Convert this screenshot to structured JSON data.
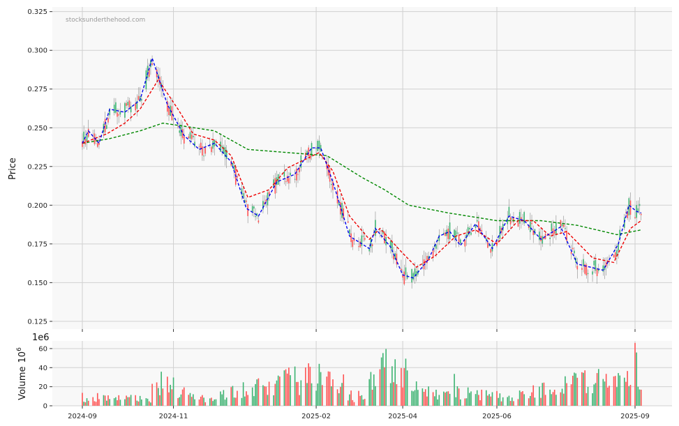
{
  "chart_data": {
    "type": "candlestick",
    "watermark": "stocksunderthehood.com",
    "colors": {
      "up": "#3cb371",
      "down": "#ff5252",
      "ma_fast": "#0000ee",
      "ma_mid": "#ee0000",
      "ma_slow": "#008800",
      "grid": "#d0d0d0",
      "panel_bg": "#f8f8f8"
    },
    "price_panel": {
      "ylabel": "Price",
      "ylim": [
        0.12,
        0.328
      ],
      "yticks": [
        "0.125",
        "0.150",
        "0.175",
        "0.200",
        "0.225",
        "0.250",
        "0.275",
        "0.300",
        "0.325"
      ],
      "grid": true
    },
    "volume_panel": {
      "ylabel": "Volume",
      "unit_label": "10",
      "unit_exp": "6",
      "offset_label": "1e6",
      "ylim": [
        0,
        68
      ],
      "yticks": [
        "0",
        "20",
        "40",
        "60"
      ],
      "grid": true
    },
    "xaxis": {
      "start": "2024-09-02",
      "end": "2025-09-05",
      "tick_dates": [
        "2024-09-02",
        "2024-11-01",
        "2025-02-03",
        "2025-04-01",
        "2025-06-02",
        "2025-09-01"
      ],
      "tick_labels": [
        "2024-09",
        "2024-11",
        "2025-02",
        "2025-04",
        "2025-06",
        "2025-09"
      ]
    },
    "price_anchors": [
      [
        "2024-09-02",
        0.24
      ],
      [
        "2024-09-06",
        0.248
      ],
      [
        "2024-09-13",
        0.24
      ],
      [
        "2024-09-20",
        0.262
      ],
      [
        "2024-09-30",
        0.26
      ],
      [
        "2024-10-10",
        0.268
      ],
      [
        "2024-10-18",
        0.295
      ],
      [
        "2024-10-28",
        0.265
      ],
      [
        "2024-11-08",
        0.245
      ],
      [
        "2024-11-18",
        0.236
      ],
      [
        "2024-11-28",
        0.24
      ],
      [
        "2024-12-09",
        0.228
      ],
      [
        "2024-12-19",
        0.198
      ],
      [
        "2024-12-27",
        0.193
      ],
      [
        "2025-01-08",
        0.215
      ],
      [
        "2025-01-20",
        0.22
      ],
      [
        "2025-01-31",
        0.237
      ],
      [
        "2025-02-06",
        0.237
      ],
      [
        "2025-02-14",
        0.215
      ],
      [
        "2025-02-25",
        0.18
      ],
      [
        "2025-03-10",
        0.172
      ],
      [
        "2025-03-14",
        0.185
      ],
      [
        "2025-03-24",
        0.173
      ],
      [
        "2025-04-01",
        0.155
      ],
      [
        "2025-04-08",
        0.153
      ],
      [
        "2025-04-18",
        0.165
      ],
      [
        "2025-04-25",
        0.18
      ],
      [
        "2025-05-02",
        0.183
      ],
      [
        "2025-05-09",
        0.174
      ],
      [
        "2025-05-19",
        0.188
      ],
      [
        "2025-05-30",
        0.172
      ],
      [
        "2025-06-10",
        0.193
      ],
      [
        "2025-06-20",
        0.19
      ],
      [
        "2025-07-01",
        0.178
      ],
      [
        "2025-07-14",
        0.186
      ],
      [
        "2025-07-25",
        0.162
      ],
      [
        "2025-08-11",
        0.158
      ],
      [
        "2025-08-21",
        0.175
      ],
      [
        "2025-08-28",
        0.2
      ],
      [
        "2025-09-02",
        0.196
      ],
      [
        "2025-09-05",
        0.195
      ]
    ],
    "ma_fast": [
      [
        "2024-09-02",
        0.24
      ],
      [
        "2024-09-06",
        0.248
      ],
      [
        "2024-09-13",
        0.24
      ],
      [
        "2024-09-20",
        0.262
      ],
      [
        "2024-09-30",
        0.26
      ],
      [
        "2024-10-10",
        0.268
      ],
      [
        "2024-10-18",
        0.295
      ],
      [
        "2024-10-28",
        0.265
      ],
      [
        "2024-11-08",
        0.245
      ],
      [
        "2024-11-18",
        0.236
      ],
      [
        "2024-11-28",
        0.24
      ],
      [
        "2024-12-09",
        0.228
      ],
      [
        "2024-12-19",
        0.198
      ],
      [
        "2024-12-27",
        0.193
      ],
      [
        "2025-01-08",
        0.215
      ],
      [
        "2025-01-20",
        0.22
      ],
      [
        "2025-01-31",
        0.237
      ],
      [
        "2025-02-06",
        0.237
      ],
      [
        "2025-02-14",
        0.215
      ],
      [
        "2025-02-25",
        0.18
      ],
      [
        "2025-03-10",
        0.172
      ],
      [
        "2025-03-14",
        0.185
      ],
      [
        "2025-03-24",
        0.173
      ],
      [
        "2025-04-01",
        0.155
      ],
      [
        "2025-04-08",
        0.153
      ],
      [
        "2025-04-18",
        0.165
      ],
      [
        "2025-04-25",
        0.18
      ],
      [
        "2025-05-02",
        0.183
      ],
      [
        "2025-05-09",
        0.174
      ],
      [
        "2025-05-19",
        0.188
      ],
      [
        "2025-05-30",
        0.172
      ],
      [
        "2025-06-10",
        0.193
      ],
      [
        "2025-06-20",
        0.19
      ],
      [
        "2025-07-01",
        0.178
      ],
      [
        "2025-07-14",
        0.186
      ],
      [
        "2025-07-25",
        0.162
      ],
      [
        "2025-08-11",
        0.158
      ],
      [
        "2025-08-21",
        0.175
      ],
      [
        "2025-08-28",
        0.2
      ],
      [
        "2025-09-02",
        0.196
      ],
      [
        "2025-09-05",
        0.195
      ]
    ],
    "ma_mid": [
      [
        "2024-09-02",
        0.24
      ],
      [
        "2024-09-10",
        0.243
      ],
      [
        "2024-09-18",
        0.246
      ],
      [
        "2024-09-30",
        0.253
      ],
      [
        "2024-10-10",
        0.262
      ],
      [
        "2024-10-22",
        0.281
      ],
      [
        "2024-11-04",
        0.262
      ],
      [
        "2024-11-14",
        0.246
      ],
      [
        "2024-11-28",
        0.242
      ],
      [
        "2024-12-09",
        0.232
      ],
      [
        "2024-12-20",
        0.205
      ],
      [
        "2025-01-03",
        0.21
      ],
      [
        "2025-01-15",
        0.224
      ],
      [
        "2025-02-05",
        0.234
      ],
      [
        "2025-02-14",
        0.222
      ],
      [
        "2025-02-25",
        0.193
      ],
      [
        "2025-03-10",
        0.178
      ],
      [
        "2025-03-17",
        0.185
      ],
      [
        "2025-03-31",
        0.17
      ],
      [
        "2025-04-10",
        0.16
      ],
      [
        "2025-04-22",
        0.167
      ],
      [
        "2025-05-06",
        0.18
      ],
      [
        "2025-05-19",
        0.184
      ],
      [
        "2025-06-02",
        0.175
      ],
      [
        "2025-06-16",
        0.19
      ],
      [
        "2025-06-26",
        0.19
      ],
      [
        "2025-07-07",
        0.18
      ],
      [
        "2025-07-18",
        0.183
      ],
      [
        "2025-08-04",
        0.166
      ],
      [
        "2025-08-18",
        0.163
      ],
      [
        "2025-08-29",
        0.185
      ],
      [
        "2025-09-05",
        0.19
      ]
    ],
    "ma_slow": [
      [
        "2024-09-02",
        0.24
      ],
      [
        "2024-09-20",
        0.243
      ],
      [
        "2024-10-10",
        0.248
      ],
      [
        "2024-10-25",
        0.253
      ],
      [
        "2024-11-08",
        0.251
      ],
      [
        "2024-11-28",
        0.248
      ],
      [
        "2024-12-20",
        0.236
      ],
      [
        "2025-01-15",
        0.234
      ],
      [
        "2025-02-10",
        0.232
      ],
      [
        "2025-03-05",
        0.218
      ],
      [
        "2025-03-20",
        0.21
      ],
      [
        "2025-04-05",
        0.2
      ],
      [
        "2025-05-01",
        0.195
      ],
      [
        "2025-06-02",
        0.19
      ],
      [
        "2025-07-01",
        0.19
      ],
      [
        "2025-07-25",
        0.187
      ],
      [
        "2025-08-20",
        0.181
      ],
      [
        "2025-09-05",
        0.184
      ]
    ],
    "volume_anchors": [
      [
        "2024-09-02",
        8
      ],
      [
        "2024-10-17",
        9
      ],
      [
        "2024-10-20",
        34
      ],
      [
        "2024-11-15",
        8
      ],
      [
        "2025-01-30",
        34
      ],
      [
        "2025-02-04",
        42
      ],
      [
        "2025-03-01",
        8
      ],
      [
        "2025-03-26",
        55
      ],
      [
        "2025-04-10",
        18
      ],
      [
        "2025-06-15",
        12
      ],
      [
        "2025-07-28",
        30
      ],
      [
        "2025-08-29",
        30
      ],
      [
        "2025-09-02",
        62
      ],
      [
        "2025-09-05",
        15
      ]
    ]
  }
}
